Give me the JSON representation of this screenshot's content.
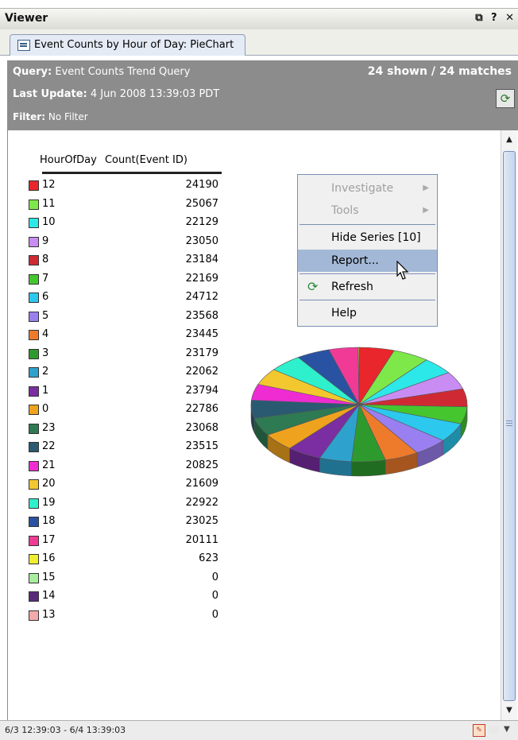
{
  "window": {
    "title": "Viewer",
    "controls": "⧉ ? ✕"
  },
  "tab": {
    "label": "Event Counts by Hour of Day: PieChart"
  },
  "info": {
    "query_label": "Query:",
    "query_value": "Event Counts Trend Query",
    "matches": "24 shown / 24 matches",
    "update_label": "Last Update:",
    "update_value": "4 Jun 2008 13:39:03 PDT",
    "filter_label": "Filter:",
    "filter_value": "No Filter"
  },
  "table": {
    "col_hour": "HourOfDay",
    "col_count": "Count(Event ID)",
    "rows": [
      {
        "hour": "12",
        "count": "24190",
        "color": "#e8262c"
      },
      {
        "hour": "11",
        "count": "25067",
        "color": "#7ee84a"
      },
      {
        "hour": "10",
        "count": "22129",
        "color": "#2ce8e8"
      },
      {
        "hour": "9",
        "count": "23050",
        "color": "#c98cf2"
      },
      {
        "hour": "8",
        "count": "23184",
        "color": "#cf2a34"
      },
      {
        "hour": "7",
        "count": "22169",
        "color": "#46c62e"
      },
      {
        "hour": "6",
        "count": "24712",
        "color": "#2cc8ee"
      },
      {
        "hour": "5",
        "count": "23568",
        "color": "#9a7ff0"
      },
      {
        "hour": "4",
        "count": "23445",
        "color": "#ee7a2c"
      },
      {
        "hour": "3",
        "count": "23179",
        "color": "#2e9a2e"
      },
      {
        "hour": "2",
        "count": "22062",
        "color": "#2ea2cc"
      },
      {
        "hour": "1",
        "count": "23794",
        "color": "#7a2ea2"
      },
      {
        "hour": "0",
        "count": "22786",
        "color": "#eea21e"
      },
      {
        "hour": "23",
        "count": "23068",
        "color": "#2e7a52"
      },
      {
        "hour": "22",
        "count": "23515",
        "color": "#2a5a72"
      },
      {
        "hour": "21",
        "count": "20825",
        "color": "#ee2cd2"
      },
      {
        "hour": "20",
        "count": "21609",
        "color": "#f2c82e"
      },
      {
        "hour": "19",
        "count": "22922",
        "color": "#2ef0cc"
      },
      {
        "hour": "18",
        "count": "23025",
        "color": "#2a52a2"
      },
      {
        "hour": "17",
        "count": "20111",
        "color": "#f03a96"
      },
      {
        "hour": "16",
        "count": "623",
        "color": "#f0ee2e"
      },
      {
        "hour": "15",
        "count": "0",
        "color": "#a8eca0"
      },
      {
        "hour": "14",
        "count": "0",
        "color": "#5a2a7a"
      },
      {
        "hour": "13",
        "count": "0",
        "color": "#f2aaaa"
      }
    ]
  },
  "chart_data": {
    "type": "pie",
    "categories": [
      "12",
      "11",
      "10",
      "9",
      "8",
      "7",
      "6",
      "5",
      "4",
      "3",
      "2",
      "1",
      "0",
      "23",
      "22",
      "21",
      "20",
      "19",
      "18",
      "17",
      "16",
      "15",
      "14",
      "13"
    ],
    "values": [
      24190,
      25067,
      22129,
      23050,
      23184,
      22169,
      24712,
      23568,
      23445,
      23179,
      22062,
      23794,
      22786,
      23068,
      23515,
      20825,
      21609,
      22922,
      23025,
      20111,
      623,
      0,
      0,
      0
    ]
  },
  "context_menu": {
    "items": [
      {
        "label": "Investigate",
        "disabled": true,
        "submenu": true
      },
      {
        "label": "Tools",
        "disabled": true,
        "submenu": true
      },
      {
        "label": "Hide Series [10]"
      },
      {
        "label": "Report..."
      },
      {
        "label": "Refresh",
        "icon": "refresh-icon"
      },
      {
        "label": "Help"
      }
    ]
  },
  "status": {
    "range": "6/3 12:39:03 - 6/4 13:39:03"
  }
}
